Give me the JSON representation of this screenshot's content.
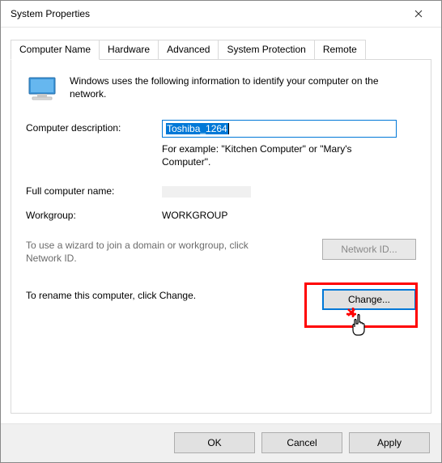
{
  "window": {
    "title": "System Properties"
  },
  "tabs": {
    "computer_name": "Computer Name",
    "hardware": "Hardware",
    "advanced": "Advanced",
    "system_protection": "System Protection",
    "remote": "Remote"
  },
  "intro": "Windows uses the following information to identify your computer on the network.",
  "labels": {
    "description": "Computer description:",
    "example": "For example: \"Kitchen Computer\" or \"Mary's Computer\".",
    "full_name": "Full computer name:",
    "workgroup": "Workgroup:"
  },
  "values": {
    "description_input": "Toshiba_1264",
    "full_name": "",
    "workgroup": "WORKGROUP"
  },
  "hints": {
    "network_id": "To use a wizard to join a domain or workgroup, click Network ID.",
    "change": "To rename this computer, click Change."
  },
  "buttons": {
    "network_id": "Network ID...",
    "change": "Change...",
    "ok": "OK",
    "cancel": "Cancel",
    "apply": "Apply"
  }
}
